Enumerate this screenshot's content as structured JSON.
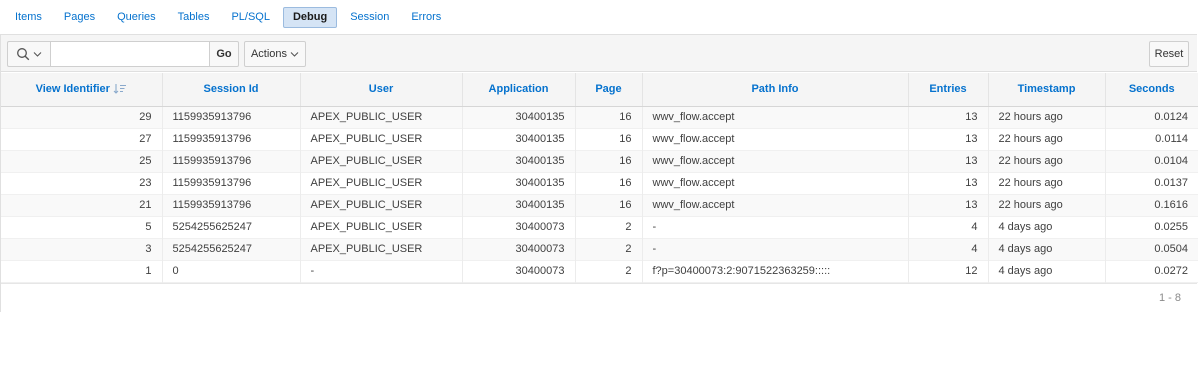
{
  "tabs": [
    {
      "label": "Items",
      "active": false
    },
    {
      "label": "Pages",
      "active": false
    },
    {
      "label": "Queries",
      "active": false
    },
    {
      "label": "Tables",
      "active": false
    },
    {
      "label": "PL/SQL",
      "active": false
    },
    {
      "label": "Debug",
      "active": true
    },
    {
      "label": "Session",
      "active": false
    },
    {
      "label": "Errors",
      "active": false
    }
  ],
  "toolbar": {
    "search_value": "",
    "go_label": "Go",
    "actions_label": "Actions",
    "reset_label": "Reset"
  },
  "columns": [
    "View Identifier",
    "Session Id",
    "User",
    "Application",
    "Page",
    "Path Info",
    "Entries",
    "Timestamp",
    "Seconds"
  ],
  "rows": [
    [
      "29",
      "1159935913796",
      "APEX_PUBLIC_USER",
      "30400135",
      "16",
      "wwv_flow.accept",
      "13",
      "22 hours ago",
      "0.0124"
    ],
    [
      "27",
      "1159935913796",
      "APEX_PUBLIC_USER",
      "30400135",
      "16",
      "wwv_flow.accept",
      "13",
      "22 hours ago",
      "0.0114"
    ],
    [
      "25",
      "1159935913796",
      "APEX_PUBLIC_USER",
      "30400135",
      "16",
      "wwv_flow.accept",
      "13",
      "22 hours ago",
      "0.0104"
    ],
    [
      "23",
      "1159935913796",
      "APEX_PUBLIC_USER",
      "30400135",
      "16",
      "wwv_flow.accept",
      "13",
      "22 hours ago",
      "0.0137"
    ],
    [
      "21",
      "1159935913796",
      "APEX_PUBLIC_USER",
      "30400135",
      "16",
      "wwv_flow.accept",
      "13",
      "22 hours ago",
      "0.1616"
    ],
    [
      "5",
      "5254255625247",
      "APEX_PUBLIC_USER",
      "30400073",
      "2",
      "-",
      "4",
      "4 days ago",
      "0.0255"
    ],
    [
      "3",
      "5254255625247",
      "APEX_PUBLIC_USER",
      "30400073",
      "2",
      "-",
      "4",
      "4 days ago",
      "0.0504"
    ],
    [
      "1",
      "0",
      "-",
      "30400073",
      "2",
      "f?p=30400073:2:9071522363259:::::",
      "12",
      "4 days ago",
      "0.0272"
    ]
  ],
  "pagination": {
    "label": "1 - 8"
  },
  "colors": {
    "link": "#0572ce",
    "active_tab_bg": "#d5e4f5"
  },
  "icons": {
    "search": "search-icon",
    "sort": "sort-descending-icon"
  }
}
